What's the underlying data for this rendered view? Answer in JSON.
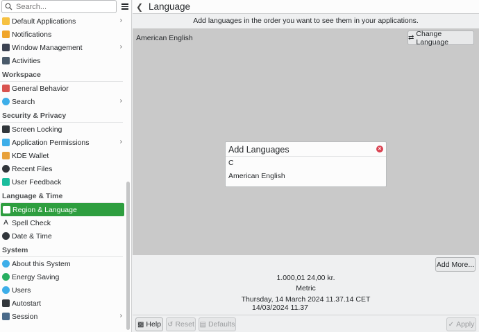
{
  "search": {
    "placeholder": "Search..."
  },
  "sidebar": {
    "items_top": [
      {
        "label": "Default Applications",
        "icon": "star-icon",
        "color": "#f6c141",
        "chevron": true
      },
      {
        "label": "Notifications",
        "icon": "bell-icon",
        "color": "#f0a52a",
        "chevron": false
      },
      {
        "label": "Window Management",
        "icon": "window-icon",
        "color": "#3b4252",
        "chevron": true
      },
      {
        "label": "Activities",
        "icon": "activities-icon",
        "color": "#4a5a6a",
        "chevron": false
      }
    ],
    "section_workspace": "Workspace",
    "items_workspace": [
      {
        "label": "General Behavior",
        "icon": "general-behavior-icon",
        "color": "#d9534f",
        "chevron": false
      },
      {
        "label": "Search",
        "icon": "search-globe-icon",
        "color": "#3daee9",
        "chevron": true
      }
    ],
    "section_security": "Security & Privacy",
    "items_security": [
      {
        "label": "Screen Locking",
        "icon": "screen-lock-icon",
        "color": "#31363b",
        "chevron": false
      },
      {
        "label": "Application Permissions",
        "icon": "shield-icon",
        "color": "#3daee9",
        "chevron": true
      },
      {
        "label": "KDE Wallet",
        "icon": "wallet-icon",
        "color": "#e8a13a",
        "chevron": false
      },
      {
        "label": "Recent Files",
        "icon": "recent-files-icon",
        "color": "#31363b",
        "chevron": false
      },
      {
        "label": "User Feedback",
        "icon": "feedback-icon",
        "color": "#1abc9c",
        "chevron": false
      }
    ],
    "section_language": "Language & Time",
    "items_language": [
      {
        "label": "Region & Language",
        "icon": "flag-icon",
        "color": "#3daee9",
        "chevron": false,
        "active": true
      },
      {
        "label": "Spell Check",
        "icon": "spell-check-icon",
        "color": "#232629",
        "chevron": false
      },
      {
        "label": "Date & Time",
        "icon": "clock-icon",
        "color": "#31363b",
        "chevron": false
      }
    ],
    "section_system": "System",
    "items_system": [
      {
        "label": "About this System",
        "icon": "info-icon",
        "color": "#3daee9",
        "chevron": false
      },
      {
        "label": "Energy Saving",
        "icon": "energy-icon",
        "color": "#27ae60",
        "chevron": false
      },
      {
        "label": "Users",
        "icon": "users-icon",
        "color": "#3daee9",
        "chevron": false
      },
      {
        "label": "Autostart",
        "icon": "autostart-icon",
        "color": "#31363b",
        "chevron": false
      },
      {
        "label": "Session",
        "icon": "session-icon",
        "color": "#4a6a8a",
        "chevron": true
      }
    ]
  },
  "header": {
    "title": "Language"
  },
  "main": {
    "instruction": "Add languages in the order you want to see them in your applications.",
    "current_language": "American English",
    "change_button": "Change Language",
    "add_more_button": "Add More...",
    "preview": {
      "numbers": "1.000,01 24,00 kr.",
      "measurement": "Metric",
      "datetime_long": "Thursday, 14 March 2024 11.37.14 CET",
      "datetime_short": "14/03/2024 11.37"
    }
  },
  "popup": {
    "title": "Add Languages",
    "options": [
      "C",
      "American English"
    ]
  },
  "footer": {
    "help": "Help",
    "reset": "Reset",
    "defaults": "Defaults",
    "apply": "Apply"
  }
}
